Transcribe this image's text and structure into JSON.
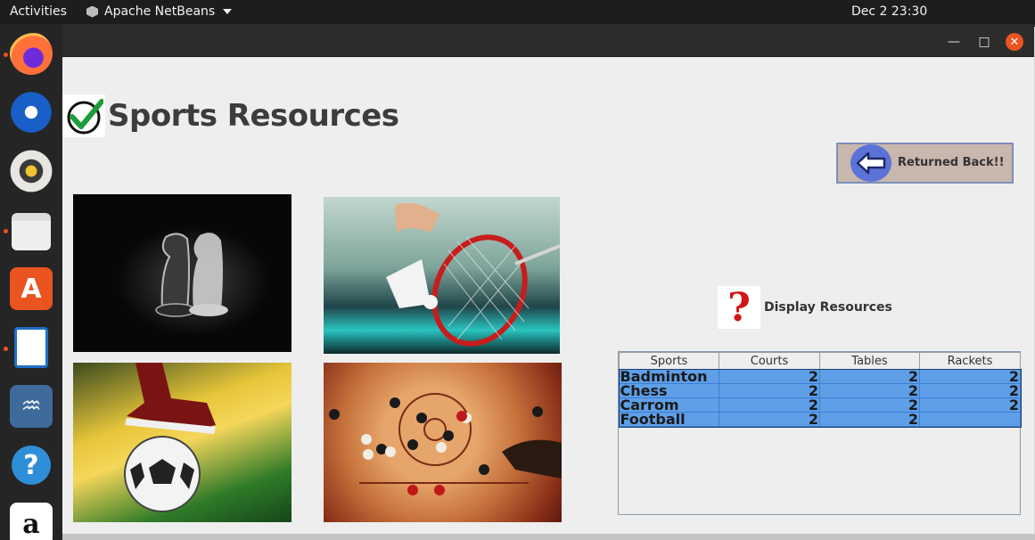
{
  "topbar": {
    "activities": "Activities",
    "app_name": "Apache NetBeans",
    "clock": "Dec 2  23:30"
  },
  "dock": {
    "items": [
      {
        "name": "firefox",
        "icon": "firefox-icon",
        "running": true
      },
      {
        "name": "thunderbird",
        "icon": "thunderbird-icon",
        "running": false
      },
      {
        "name": "rhythmbox",
        "icon": "rhythmbox-icon",
        "running": false
      },
      {
        "name": "files",
        "icon": "files-icon",
        "running": true
      },
      {
        "name": "software",
        "icon": "software-icon",
        "running": false
      },
      {
        "name": "writer",
        "icon": "writer-icon",
        "running": true
      },
      {
        "name": "mysql-workbench",
        "icon": "mysql-icon",
        "running": false
      },
      {
        "name": "help",
        "icon": "help-icon",
        "running": false
      },
      {
        "name": "amazon",
        "icon": "amazon-icon",
        "running": false
      }
    ]
  },
  "window": {
    "controls": {
      "minimize": "—",
      "maximize": "□",
      "close": "✕"
    }
  },
  "main": {
    "title": "Sports Resources",
    "back_button_label": "Returned Back!!",
    "display_label": "Display Resources",
    "images": [
      {
        "name": "chess-image",
        "alt": "chess"
      },
      {
        "name": "badminton-image",
        "alt": "badminton"
      },
      {
        "name": "football-image",
        "alt": "football"
      },
      {
        "name": "carrom-image",
        "alt": "carrom"
      }
    ],
    "table": {
      "columns": [
        "Sports",
        "Courts",
        "Tables",
        "Rackets"
      ],
      "rows": [
        [
          "Badminton",
          "2",
          "2",
          "2"
        ],
        [
          "Chess",
          "2",
          "2",
          "2"
        ],
        [
          "Carrom",
          "2",
          "2",
          "2"
        ],
        [
          "Football",
          "2",
          "2",
          ""
        ]
      ]
    }
  },
  "colors": {
    "accent": "#e95420",
    "selection": "#5e9fe8",
    "button_bg": "#c8b7ad"
  }
}
